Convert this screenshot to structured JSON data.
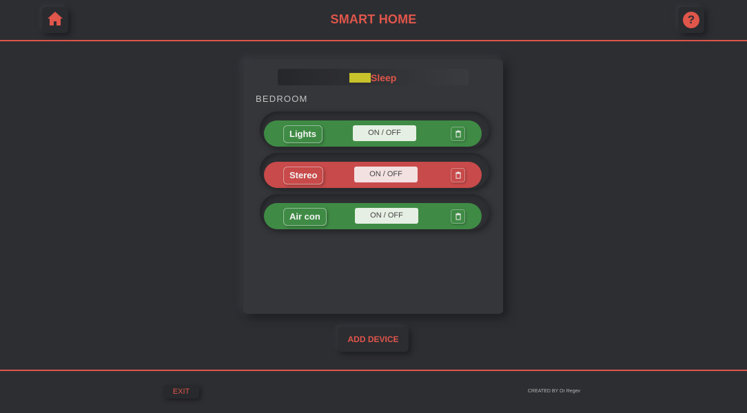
{
  "app": {
    "title": "SMART HOME",
    "accent_color": "#e0564b",
    "home_icon": "home-icon",
    "help_icon": "help-icon",
    "help_glyph": "?"
  },
  "room": {
    "mode_label": "Sleep",
    "mode_color": "#c8c32b",
    "name": "BEDROOM",
    "devices": [
      {
        "name": "Lights",
        "toggle_label": "ON / OFF",
        "status": "on",
        "status_color": "#3f8b45",
        "delete_icon": "trash-icon"
      },
      {
        "name": "Stereo",
        "toggle_label": "ON / OFF",
        "status": "off",
        "status_color": "#c84a4a",
        "delete_icon": "trash-icon"
      },
      {
        "name": "Air con",
        "toggle_label": "ON / OFF",
        "status": "on",
        "status_color": "#3f8b45",
        "delete_icon": "trash-icon"
      }
    ]
  },
  "actions": {
    "add_device_label": "ADD DEVICE"
  },
  "footer": {
    "exit_label": "EXIT",
    "credit": "CREATED BY Or Regev"
  }
}
